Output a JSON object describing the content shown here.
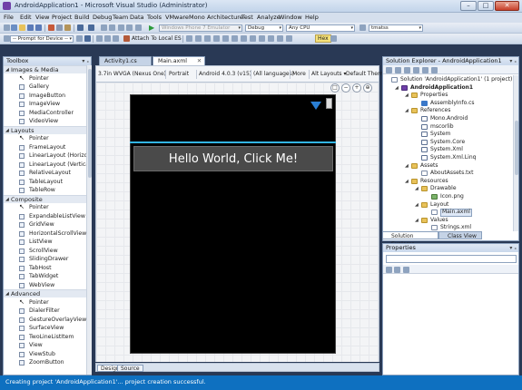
{
  "window": {
    "title": "AndroidApplication1 - Microsoft Visual Studio (Administrator)",
    "minimize": "–",
    "maximize": "□",
    "close": "✕"
  },
  "menu": [
    "File",
    "Edit",
    "View",
    "Project",
    "Build",
    "Debug",
    "Team",
    "Data",
    "Tools",
    "VMware",
    "Mono",
    "Architecture",
    "Test",
    "Analyze",
    "Window",
    "Help"
  ],
  "toolbar1": {
    "emulator_combo": "Windows Phone 7 Emulator",
    "config_combo": "Debug",
    "platform_combo": "Any CPU",
    "hex_label": "Hex",
    "search_combo": "tmatss"
  },
  "toolbar2": {
    "device_prompt": "-- Prompt for Device --",
    "attach_label": "Attach To Local ES"
  },
  "toolbox": {
    "title": "Toolbox",
    "pin": "▾ ₓ",
    "categories": [
      {
        "label": "Images & Media",
        "items": [
          "Pointer",
          "Gallery",
          "ImageButton",
          "ImageView",
          "MediaController",
          "VideoView"
        ]
      },
      {
        "label": "Layouts",
        "items": [
          "Pointer",
          "FrameLayout",
          "LinearLayout (Horizon...",
          "LinearLayout (Vertical)",
          "RelativeLayout",
          "TableLayout",
          "TableRow"
        ]
      },
      {
        "label": "Composite",
        "items": [
          "Pointer",
          "ExpandableListView",
          "GridView",
          "HorizontalScrollView",
          "ListView",
          "ScrollView",
          "SlidingDrawer",
          "TabHost",
          "TabWidget",
          "WebView"
        ]
      },
      {
        "label": "Advanced",
        "items": [
          "Pointer",
          "DialerFilter",
          "GestureOverlayView",
          "SurfaceView",
          "TwoLineListItem",
          "View",
          "ViewStub",
          "ZoomButton"
        ]
      }
    ]
  },
  "doc_tabs": [
    {
      "label": "Activity1.cs",
      "active": false
    },
    {
      "label": "Main.axml",
      "active": true
    }
  ],
  "doc_close": "✕",
  "designer": {
    "device": "3.7in WVGA (Nexus One)",
    "orientation": "Portrait",
    "api": "Android 4.0.3 (v15)",
    "language": "(All languages)",
    "more": "More",
    "alt_layouts": "Alt Layouts ▾",
    "theme": "Default Theme",
    "button_text": "Hello World, Click Me!",
    "zoom_icons": [
      "□",
      "−",
      "+",
      "⊕"
    ]
  },
  "view_tabs": [
    {
      "label": "Design",
      "active": true
    },
    {
      "label": "Source",
      "active": false
    }
  ],
  "solution_explorer": {
    "title": "Solution Explorer - AndroidApplication1",
    "items": [
      {
        "label": "Solution 'AndroidApplication1' (1 project)",
        "indent": 0,
        "icon": "file",
        "exp": ""
      },
      {
        "label": "AndroidApplication1",
        "indent": 1,
        "icon": "proj",
        "exp": "◢",
        "bold": true
      },
      {
        "label": "Properties",
        "indent": 2,
        "icon": "folder",
        "exp": "◢"
      },
      {
        "label": "AssemblyInfo.cs",
        "indent": 3,
        "icon": "cs",
        "exp": ""
      },
      {
        "label": "References",
        "indent": 2,
        "icon": "folder",
        "exp": "◢"
      },
      {
        "label": "Mono.Android",
        "indent": 3,
        "icon": "ref",
        "exp": ""
      },
      {
        "label": "mscorlib",
        "indent": 3,
        "icon": "ref",
        "exp": ""
      },
      {
        "label": "System",
        "indent": 3,
        "icon": "ref",
        "exp": ""
      },
      {
        "label": "System.Core",
        "indent": 3,
        "icon": "ref",
        "exp": ""
      },
      {
        "label": "System.Xml",
        "indent": 3,
        "icon": "ref",
        "exp": ""
      },
      {
        "label": "System.Xml.Linq",
        "indent": 3,
        "icon": "ref",
        "exp": ""
      },
      {
        "label": "Assets",
        "indent": 2,
        "icon": "folder",
        "exp": "◢"
      },
      {
        "label": "AboutAssets.txt",
        "indent": 3,
        "icon": "file",
        "exp": ""
      },
      {
        "label": "Resources",
        "indent": 2,
        "icon": "folder",
        "exp": "◢"
      },
      {
        "label": "Drawable",
        "indent": 3,
        "icon": "folder",
        "exp": "◢"
      },
      {
        "label": "Icon.png",
        "indent": 4,
        "icon": "img",
        "exp": ""
      },
      {
        "label": "Layout",
        "indent": 3,
        "icon": "folder",
        "exp": "◢"
      },
      {
        "label": "Main.axml",
        "indent": 4,
        "icon": "file",
        "exp": "",
        "selected": true
      },
      {
        "label": "Values",
        "indent": 3,
        "icon": "folder",
        "exp": "◢"
      },
      {
        "label": "Strings.xml",
        "indent": 4,
        "icon": "file",
        "exp": ""
      }
    ],
    "tabs": [
      "Solution Explorer",
      "Class View"
    ]
  },
  "properties": {
    "title": "Properties"
  },
  "status": {
    "text": "Creating project 'AndroidApplication1'... project creation successful."
  },
  "colors": {
    "statusbar": "#0e70c0",
    "accent": "#33b5e5"
  }
}
